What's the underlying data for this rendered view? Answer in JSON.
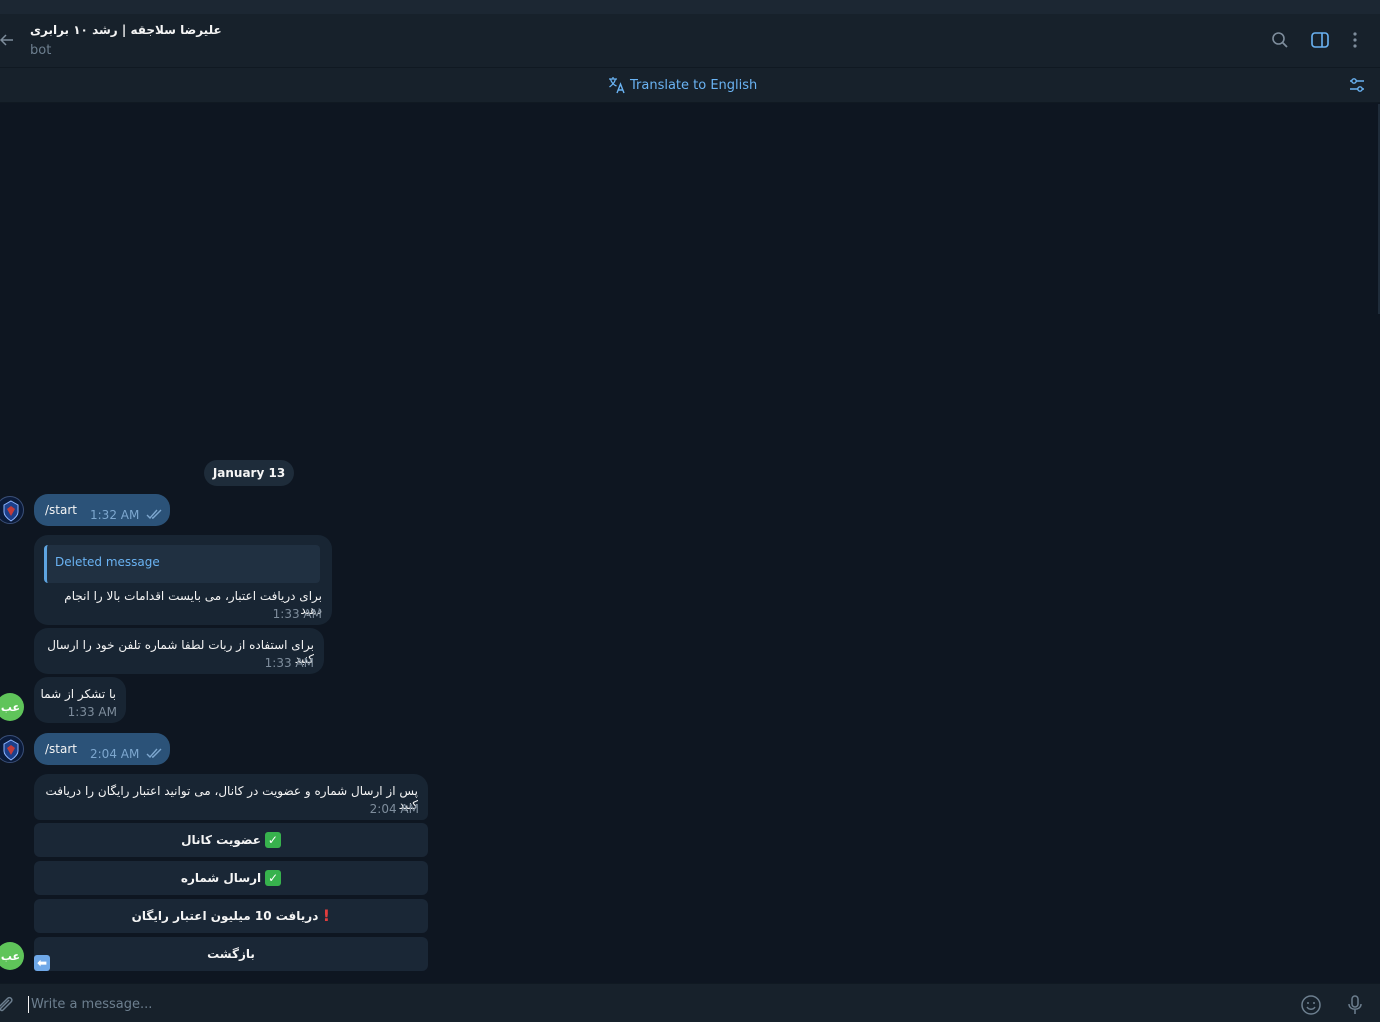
{
  "header": {
    "title": "علیرضا سلاجقه | رشد ۱۰ برابری",
    "subtitle": "bot"
  },
  "translate_bar": {
    "label": "Translate to English"
  },
  "date_chip": "January 13",
  "messages": [
    {
      "text": "/start",
      "time": "1:32 AM",
      "status": "read"
    },
    {
      "quote": "Deleted message",
      "text": "برای دریافت اعتبار، می بایست اقدامات بالا را انجام دهید",
      "time": "1:33 AM"
    },
    {
      "text": "برای استفاده از ربات لطفا شماره تلفن خود را ارسال کنید",
      "time": "1:33 AM"
    },
    {
      "text": "با تشکر از شما",
      "time": "1:33 AM"
    },
    {
      "text": "/start",
      "time": "2:04 AM",
      "status": "read"
    },
    {
      "text": "پس از ارسال شماره و عضویت در کانال، می توانید اعتبار رایگان را دریافت کنید",
      "time": "2:04 AM"
    }
  ],
  "keyboard": [
    {
      "label": "عضویت کانال",
      "icon": "check-mark-icon"
    },
    {
      "label": "ارسال شماره",
      "icon": "check-mark-icon"
    },
    {
      "label": "دریافت 10 میلیون اعتبار رایگان",
      "icon": "exclamation-icon"
    },
    {
      "label": "بازگشت",
      "icon": "back-arrow-icon"
    }
  ],
  "avatars": {
    "user_initials": "عب"
  },
  "composer": {
    "placeholder": "Write a message..."
  },
  "colors": {
    "background": "#0e1621",
    "header": "#17212b",
    "outgoing_bubble": "#2b5278",
    "incoming_bubble": "#182533",
    "accent": "#6ab3f3",
    "user_avatar": "#5fc45a"
  }
}
